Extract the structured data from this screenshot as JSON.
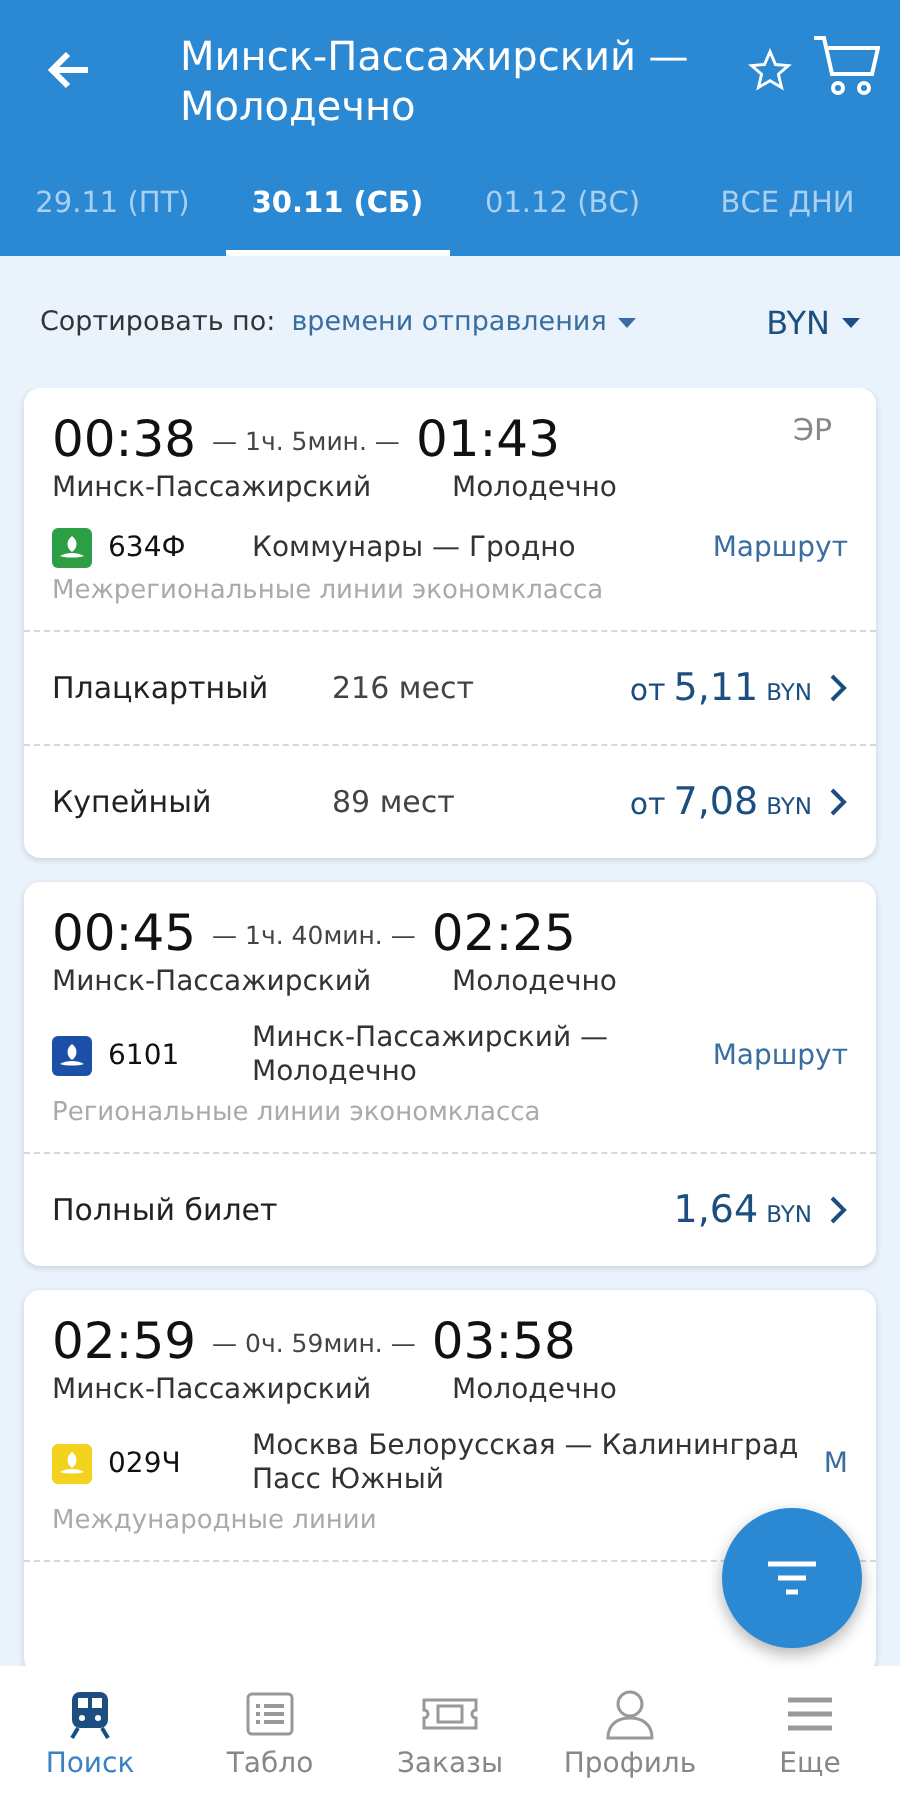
{
  "header": {
    "title": "Минск-Пассажирский — Молодечно"
  },
  "tabs": [
    {
      "label": "29.11  (ПТ)",
      "selected": false
    },
    {
      "label": "30.11  (СБ)",
      "selected": true
    },
    {
      "label": "01.12  (ВС)",
      "selected": false
    },
    {
      "label": "ВСЕ ДНИ",
      "selected": false
    }
  ],
  "sort": {
    "label": "Сортировать по:",
    "value": "времени отправления",
    "currency": "BYN"
  },
  "trains": [
    {
      "depart": "00:38",
      "duration": "— 1ч. 5мин. —",
      "arrive": "01:43",
      "from": "Минск-Пассажирский",
      "to": "Молодечно",
      "type": "ЭР",
      "color": "#2e9e44",
      "number": "634Ф",
      "name": "Коммунары — Гродно",
      "route": "Маршрут",
      "category": "Межрегиональные линии экономкласса",
      "fares": [
        {
          "class": "Плацкартный",
          "seats": "216 мест",
          "prefix": "от",
          "amount": "5,11",
          "currency": "BYN"
        },
        {
          "class": "Купейный",
          "seats": "89 мест",
          "prefix": "от",
          "amount": "7,08",
          "currency": "BYN"
        }
      ]
    },
    {
      "depart": "00:45",
      "duration": "— 1ч. 40мин. —",
      "arrive": "02:25",
      "from": "Минск-Пассажирский",
      "to": "Молодечно",
      "color": "#1c4fa8",
      "number": "6101",
      "name": "Минск-Пассажирский — Молодечно",
      "route": "Маршрут",
      "category": "Региональные линии экономкласса",
      "fares": [
        {
          "class": "Полный билет",
          "amount": "1,64",
          "currency": "BYN"
        }
      ]
    },
    {
      "depart": "02:59",
      "duration": "— 0ч. 59мин. —",
      "arrive": "03:58",
      "from": "Минск-Пассажирский",
      "to": "Молодечно",
      "color": "#f2d21d",
      "number": "029Ч",
      "name": "Москва Белорусская — Калининград Пасс Южный",
      "route": "М",
      "category": "Международные линии"
    }
  ],
  "nav": [
    {
      "label": "Поиск",
      "kind": "train",
      "selected": true
    },
    {
      "label": "Табло",
      "kind": "board",
      "selected": false
    },
    {
      "label": "Заказы",
      "kind": "ticket",
      "selected": false
    },
    {
      "label": "Профиль",
      "kind": "person",
      "selected": false
    },
    {
      "label": "Еще",
      "kind": "menu",
      "selected": false
    }
  ]
}
